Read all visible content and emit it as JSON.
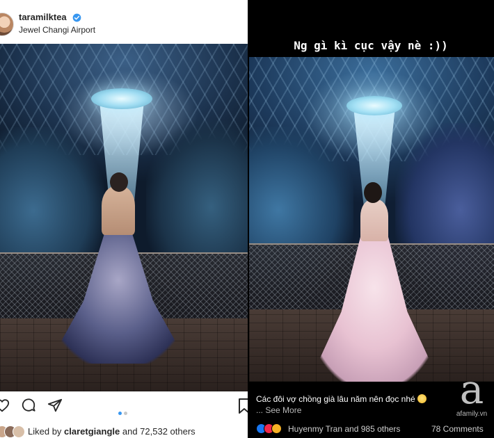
{
  "instagram": {
    "username": "taramilktea",
    "location": "Jewel Changi Airport",
    "liked_by_prefix": "Liked by",
    "liked_by_user": "claretgiangle",
    "liked_by_suffix": "and 72,532 others",
    "carousel": {
      "total": 2,
      "active": 1
    },
    "icons": [
      "verified-icon",
      "heart-icon",
      "comment-icon",
      "share-icon",
      "bookmark-icon"
    ],
    "colors": {
      "verified": "#3897f0",
      "dot_active": "#3897f0",
      "dot_inactive": "#c7c7c7"
    }
  },
  "facebook": {
    "story_caption": "Ng gì kì cục vậy nè :))",
    "post_text": "Các đôi vợ chồng già lâu năm nên đọc nhé",
    "see_more": "... See More",
    "reactions_text": "Huyenmy Tran and 985 others",
    "comments": "78 Comments",
    "reaction_icons": [
      "like-icon",
      "love-icon",
      "wow-icon"
    ],
    "colors": {
      "like": "#1877f2",
      "love": "#f0284a",
      "wow": "#f7b125"
    }
  },
  "watermark": {
    "text": "afamily.vn"
  }
}
